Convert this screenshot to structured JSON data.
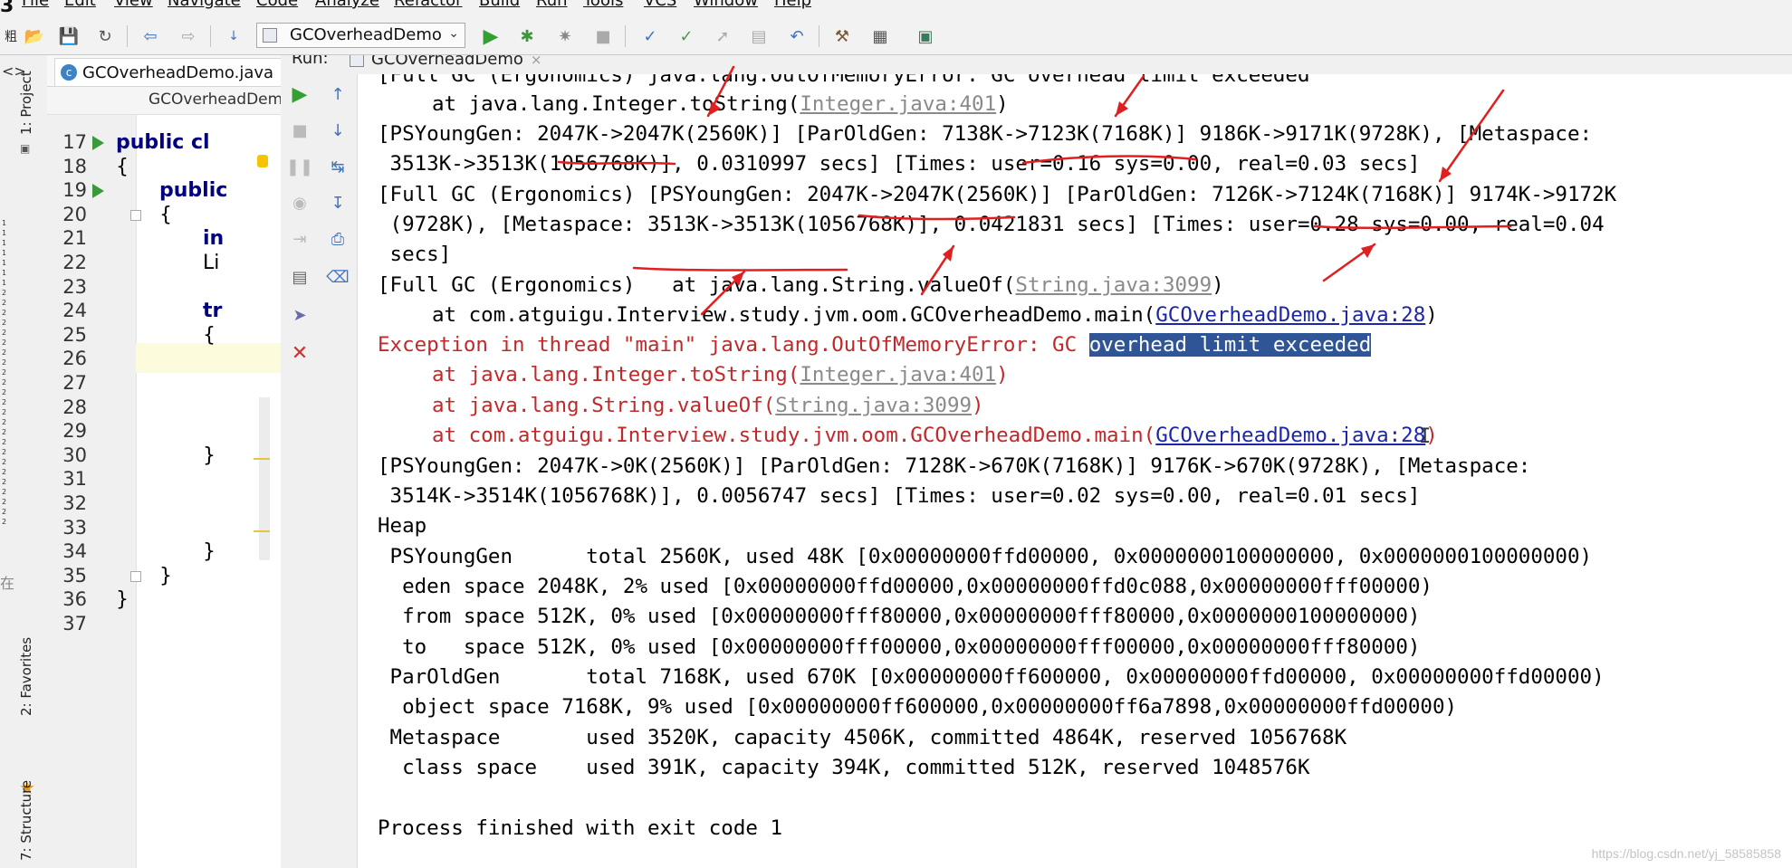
{
  "left_edge_glyph": "3",
  "menu": [
    "File",
    "Edit",
    "View",
    "Navigate",
    "Code",
    "Analyze",
    "Refactor",
    "Build",
    "Run",
    "Tools",
    "VCS",
    "Window",
    "Help"
  ],
  "toolbar": {
    "run_config": "GCOverheadDemo"
  },
  "left_strip": {
    "project_label": "1: Project",
    "favorites_label": "2: Favorites",
    "structure_label": "7: Structure",
    "cjk_top": "粗",
    "cjk_mid": "在"
  },
  "editor": {
    "tab": "GCOverheadDemo.java",
    "breadcrumb": "GCOverheadDem",
    "lines": [
      {
        "n": "17",
        "code": "public cl"
      },
      {
        "n": "18",
        "code": "{"
      },
      {
        "n": "19",
        "code": "public"
      },
      {
        "n": "20",
        "code": "{"
      },
      {
        "n": "21",
        "code": "in"
      },
      {
        "n": "22",
        "code": "Li"
      },
      {
        "n": "23",
        "code": ""
      },
      {
        "n": "24",
        "code": "tr"
      },
      {
        "n": "25",
        "code": "{"
      },
      {
        "n": "26",
        "code": ""
      },
      {
        "n": "27",
        "code": ""
      },
      {
        "n": "28",
        "code": ""
      },
      {
        "n": "29",
        "code": ""
      },
      {
        "n": "30",
        "code": "}"
      },
      {
        "n": "31",
        "code": ""
      },
      {
        "n": "32",
        "code": ""
      },
      {
        "n": "33",
        "code": ""
      },
      {
        "n": "34",
        "code": "}"
      },
      {
        "n": "35",
        "code": "}"
      },
      {
        "n": "36",
        "code": "}"
      },
      {
        "n": "37",
        "code": ""
      }
    ]
  },
  "run": {
    "label": "Run:",
    "tab": "GCOverheadDemo"
  },
  "console": {
    "l0": "[Full GC (Ergonomics) java.lang.OutOfMemoryError: GC overhead limit exceeded",
    "l1_pre": "at java.lang.Integer.toString(",
    "l1_link": "Integer.java:401",
    "l1_post": ")",
    "l2": "[PSYoungGen: 2047K->2047K(2560K)] [ParOldGen: 7138K->7123K(7168K)] 9186K->9171K(9728K), [Metaspace:",
    "l3": " 3513K->3513K(1056768K)], 0.0310997 secs] [Times: user=0.16 sys=0.00, real=0.03 secs]",
    "l4": "[Full GC (Ergonomics) [PSYoungGen: 2047K->2047K(2560K)] [ParOldGen: 7126K->7124K(7168K)] 9174K->9172K",
    "l5": " (9728K), [Metaspace: 3513K->3513K(1056768K)], 0.0421831 secs] [Times: user=0.28 sys=0.00, real=0.04",
    "l6": " secs]",
    "l7_pre": "[Full GC (Ergonomics)   at java.lang.String.valueOf(",
    "l7_link": "String.java:3099",
    "l7_post": ")",
    "l8_pre": "at com.atguigu.Interview.study.jvm.oom.GCOverheadDemo.main(",
    "l8_link": "GCOverheadDemo.java:28",
    "l8_post": ")",
    "l9_pre": "Exception in thread \"main\" java.lang.OutOfMemoryError: GC ",
    "l9_sel": "overhead limit exceeded",
    "l10_pre": "at java.lang.Integer.toString(",
    "l10_link": "Integer.java:401",
    "l10_post": ")",
    "l11_pre": "at java.lang.String.valueOf(",
    "l11_link": "String.java:3099",
    "l11_post": ")",
    "l12_pre": "at com.atguigu.Interview.study.jvm.oom.GCOverheadDemo.main(",
    "l12_link": "GCOverheadDemo.java:28",
    "l12_post": ")",
    "l13": "[PSYoungGen: 2047K->0K(2560K)] [ParOldGen: 7128K->670K(7168K)] 9176K->670K(9728K), [Metaspace:",
    "l14": " 3514K->3514K(1056768K)], 0.0056747 secs] [Times: user=0.02 sys=0.00, real=0.01 secs]",
    "l15": "Heap",
    "l16": " PSYoungGen      total 2560K, used 48K [0x00000000ffd00000, 0x0000000100000000, 0x0000000100000000)",
    "l17": "  eden space 2048K, 2% used [0x00000000ffd00000,0x00000000ffd0c088,0x00000000fff00000)",
    "l18": "  from space 512K, 0% used [0x00000000fff80000,0x00000000fff80000,0x0000000100000000)",
    "l19": "  to   space 512K, 0% used [0x00000000fff00000,0x00000000fff00000,0x00000000fff80000)",
    "l20": " ParOldGen       total 7168K, used 670K [0x00000000ff600000, 0x00000000ffd00000, 0x00000000ffd00000)",
    "l21": "  object space 7168K, 9% used [0x00000000ff600000,0x00000000ff6a7898,0x00000000ffd00000)",
    "l22": " Metaspace       used 3520K, capacity 4506K, committed 4864K, reserved 1056768K",
    "l23": "  class space    used 391K, capacity 394K, committed 512K, reserved 1048576K",
    "l24": "Process finished with exit code 1"
  },
  "watermark": "https://blog.csdn.net/yj_58585858",
  "colors": {
    "annotation": "#e02020",
    "selection": "#2f5597",
    "error_text": "#c0282a",
    "link": "#1b27a8"
  }
}
